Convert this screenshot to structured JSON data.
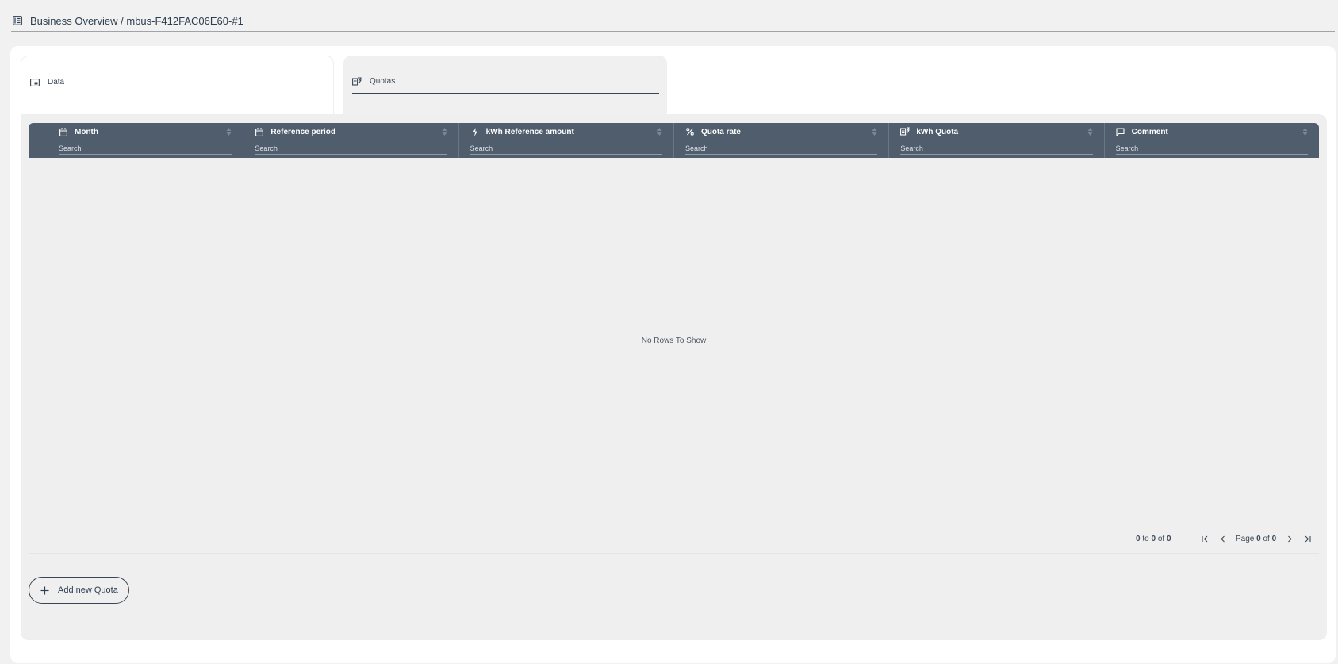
{
  "breadcrumb": {
    "title": "Business Overview / mbus-F412FAC06E60-#1",
    "icon": "list-icon"
  },
  "tabs": [
    {
      "label": "Data",
      "icon": "card-icon",
      "active": false
    },
    {
      "label": "Quotas",
      "icon": "quota-icon",
      "active": true
    }
  ],
  "grid": {
    "columns": [
      {
        "label": "Month",
        "icon": "calendar-icon",
        "search_placeholder": "Search"
      },
      {
        "label": "Reference period",
        "icon": "calendar-icon",
        "search_placeholder": "Search"
      },
      {
        "label": "kWh Reference amount",
        "icon": "bolt-icon",
        "search_placeholder": "Search"
      },
      {
        "label": "Quota rate",
        "icon": "percent-icon",
        "search_placeholder": "Search"
      },
      {
        "label": "kWh Quota",
        "icon": "quota-icon",
        "search_placeholder": "Search"
      },
      {
        "label": "Comment",
        "icon": "comment-icon",
        "search_placeholder": "Search"
      }
    ],
    "empty_message": "No Rows To Show"
  },
  "pagination": {
    "from": "0",
    "to_word": "to",
    "to": "0",
    "of_word": "of",
    "total": "0",
    "page_word": "Page",
    "page": "0",
    "page_of_word": "of",
    "page_total": "0"
  },
  "actions": {
    "add_label": "Add new Quota"
  },
  "colors": {
    "header_bg": "#4f5d6c",
    "accent": "#2d3e50",
    "panel_bg": "#efefef"
  }
}
